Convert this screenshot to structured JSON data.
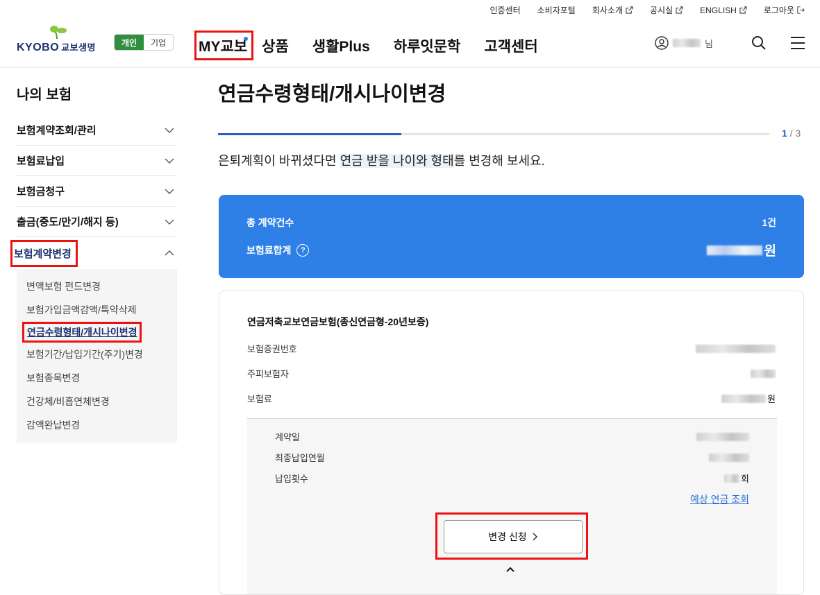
{
  "util": {
    "cert": "인증센터",
    "consumer": "소비자포털",
    "company": "회사소개",
    "notice": "공시실",
    "english": "ENGLISH",
    "logout": "로그아웃"
  },
  "header": {
    "logo_main": "KYOBO",
    "logo_sub": "교보생명",
    "seg_personal": "개인",
    "seg_corp": "기업",
    "nav": [
      "MY교보",
      "상품",
      "생활Plus",
      "하루잇문학",
      "고객센터"
    ],
    "user_suffix": "님"
  },
  "sidebar": {
    "title": "나의 보험",
    "items": [
      {
        "label": "보험계약조회/관리"
      },
      {
        "label": "보험료납입"
      },
      {
        "label": "보험금청구"
      },
      {
        "label": "출금(중도/만기/해지 등)"
      },
      {
        "label": "보험계약변경"
      }
    ],
    "sub": [
      "변액보험 펀드변경",
      "보험가입금액감액/특약삭제",
      "연금수령형태/개시나이변경",
      "보험기간/납입기간(주기)변경",
      "보험종목변경",
      "건강체/비흡연체변경",
      "감액완납변경"
    ]
  },
  "main": {
    "title": "연금수령형태/개시나이변경",
    "step_current": "1",
    "step_total": "/ 3",
    "progress": 0.333,
    "lead_pre": "은퇴계획이 바뀌셨다면 ",
    "lead_hl": "연금 받을 나이와 형태",
    "lead_post": "를 변경해 보세요.",
    "summary": {
      "count_label": "총 계약건수",
      "count_value": "1건",
      "premium_label": "보험료합계",
      "help": "?",
      "premium_unit": "원"
    },
    "contract": {
      "name": "연금저축교보연금보험(종신연금형-20년보증)",
      "policy_no_label": "보험증권번호",
      "insured_label": "주피보험자",
      "premium_label": "보험료",
      "premium_unit": "원",
      "contract_date_label": "계약일",
      "last_paid_label": "최종납입연월",
      "pay_count_label": "납입횟수",
      "pay_count_unit": "회",
      "estimate_link": "예상 연금 조회",
      "apply_button": "변경 신청"
    }
  }
}
